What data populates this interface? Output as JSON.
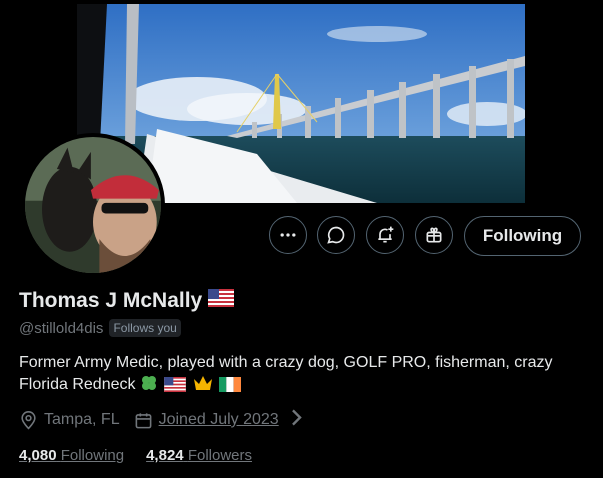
{
  "profile": {
    "name": "Thomas J McNally",
    "name_flag": "us-flag",
    "handle": "@stillold4dis",
    "follows_you": "Follows you",
    "bio_text": "Former Army Medic, played with a crazy dog, GOLF PRO, fisherman, crazy Florida Redneck",
    "bio_emojis": [
      "four-leaf-clover",
      "us-flag",
      "crown",
      "ireland-flag"
    ],
    "location": "Tampa, FL",
    "joined": "Joined July 2023",
    "following_count": "4,080",
    "following_label": "Following",
    "followers_count": "4,824",
    "followers_label": "Followers"
  },
  "actions": {
    "more_icon": "ellipsis-icon",
    "message_icon": "message-icon",
    "notify_icon": "bell-plus-icon",
    "gift_icon": "gift-icon",
    "following_button": "Following"
  },
  "banner": {
    "subject": "bridge-over-water-photo"
  },
  "colors": {
    "background": "#000000",
    "text": "#e7e9ea",
    "muted": "#71767b",
    "border": "#536471"
  }
}
